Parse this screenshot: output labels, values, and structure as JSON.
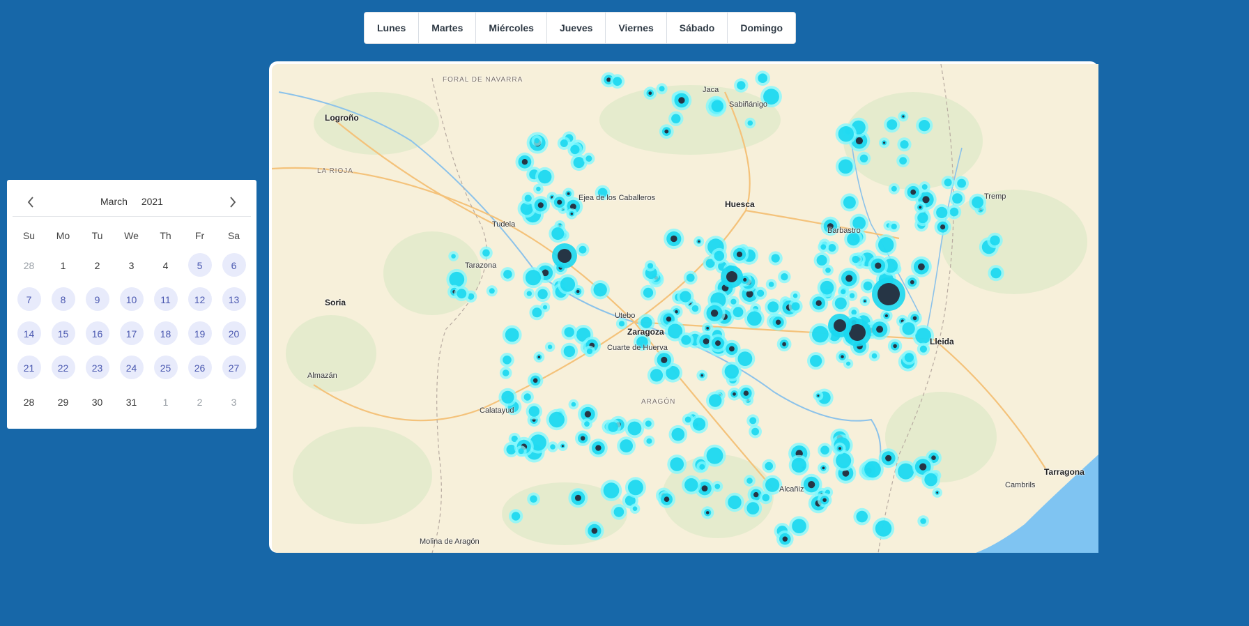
{
  "day_tabs": [
    "Lunes",
    "Martes",
    "Miércoles",
    "Jueves",
    "Viernes",
    "Sábado",
    "Domingo"
  ],
  "calendar": {
    "month": "March",
    "year": "2021",
    "weekdays": [
      "Su",
      "Mo",
      "Tu",
      "We",
      "Th",
      "Fr",
      "Sa"
    ],
    "weeks": [
      [
        {
          "d": "28",
          "s": "muted"
        },
        {
          "d": "1",
          "s": "normal"
        },
        {
          "d": "2",
          "s": "normal"
        },
        {
          "d": "3",
          "s": "normal"
        },
        {
          "d": "4",
          "s": "normal"
        },
        {
          "d": "5",
          "s": "hl"
        },
        {
          "d": "6",
          "s": "hl"
        }
      ],
      [
        {
          "d": "7",
          "s": "hl"
        },
        {
          "d": "8",
          "s": "hl"
        },
        {
          "d": "9",
          "s": "hl"
        },
        {
          "d": "10",
          "s": "hl"
        },
        {
          "d": "11",
          "s": "hl"
        },
        {
          "d": "12",
          "s": "hl"
        },
        {
          "d": "13",
          "s": "hl"
        }
      ],
      [
        {
          "d": "14",
          "s": "hl"
        },
        {
          "d": "15",
          "s": "hl"
        },
        {
          "d": "16",
          "s": "hl"
        },
        {
          "d": "17",
          "s": "hl"
        },
        {
          "d": "18",
          "s": "hl"
        },
        {
          "d": "19",
          "s": "hl"
        },
        {
          "d": "20",
          "s": "hl"
        }
      ],
      [
        {
          "d": "21",
          "s": "hl"
        },
        {
          "d": "22",
          "s": "hl"
        },
        {
          "d": "23",
          "s": "hl"
        },
        {
          "d": "24",
          "s": "hl"
        },
        {
          "d": "25",
          "s": "hl"
        },
        {
          "d": "26",
          "s": "hl"
        },
        {
          "d": "27",
          "s": "hl"
        }
      ],
      [
        {
          "d": "28",
          "s": "normal"
        },
        {
          "d": "29",
          "s": "normal"
        },
        {
          "d": "30",
          "s": "normal"
        },
        {
          "d": "31",
          "s": "normal"
        },
        {
          "d": "1",
          "s": "muted"
        },
        {
          "d": "2",
          "s": "muted"
        },
        {
          "d": "3",
          "s": "muted"
        }
      ]
    ],
    "prev_icon": "chevron-left-icon",
    "next_icon": "chevron-right-icon"
  },
  "map": {
    "places": [
      "FORAL DE NAVARRA",
      "Logroño",
      "LA RIOJA",
      "Jaca",
      "Sabiñánigo",
      "Ejea de los Caballeros",
      "Huesca",
      "Barbastro",
      "Tremp",
      "Tudela",
      "Tarazona",
      "Soria",
      "Utebo",
      "Zaragoza",
      "Cuarte de Huerva",
      "Lleida",
      "Almazán",
      "Calatayud",
      "ARAGÓN",
      "Alcañiz",
      "Tarragona",
      "Cambrils",
      "Molina de Aragón"
    ],
    "heat_colors": {
      "low": "#7ff8ff",
      "mid": "#1ad7f0",
      "high": "#263545"
    },
    "land_color": "#f7f0da",
    "sea_color": "#7fc4f2"
  }
}
